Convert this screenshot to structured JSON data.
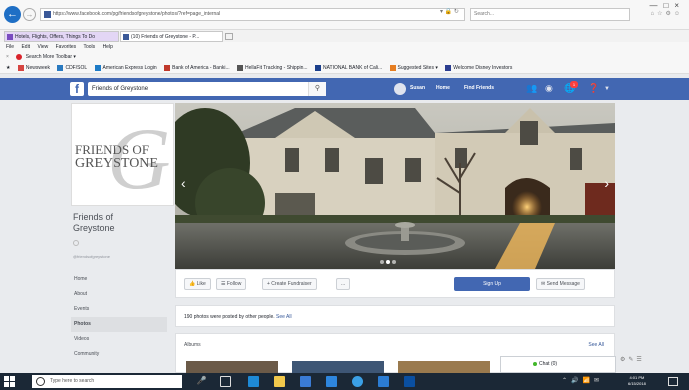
{
  "browser": {
    "address": "https://www.facebook.com/pg/friendsofgreystone/photos/?ref=page_internal",
    "search_placeholder": "Search...",
    "tabs": [
      {
        "label": "Hotels, Flights, Offers, Things To Do"
      },
      {
        "label": "(10) Friends of Greystone - P..."
      }
    ],
    "menu": [
      "File",
      "Edit",
      "View",
      "Favorites",
      "Tools",
      "Help"
    ],
    "toolbar": {
      "close": "×",
      "label": "Search More Toolbar ▾"
    },
    "favorites": [
      "Newsweek",
      "CDF/SOL",
      "American Express Login",
      "Bank of America - Banki...",
      "HellaFit Tracking - Shippin...",
      "NATIONAL BANK of Cali...",
      "Suggested Sites ▾",
      "Welcome Disney Investors"
    ]
  },
  "facebook": {
    "search_value": "Friends of Greystone",
    "user_name": "Susan",
    "nav_home": "Home",
    "nav_find_friends": "Find Friends",
    "notif_count": "1"
  },
  "page": {
    "logo_line1": "FRIENDS OF",
    "logo_line2": "GREYSTONE",
    "name": "Friends of Greystone",
    "handle": "@friendsofgreystone",
    "nav": [
      "Home",
      "About",
      "Events",
      "Photos",
      "Videos",
      "Community"
    ],
    "active_nav": "Photos",
    "actions": {
      "like": "Like",
      "follow": "Follow",
      "fundraiser": "+ Create Fundraiser",
      "more": "...",
      "signup": "Sign Up",
      "message": "Send Message"
    },
    "notice_text": "190 photos were posted by other people.",
    "notice_link": "See All",
    "albums_title": "Albums",
    "albums_see_all": "See All"
  },
  "chat": {
    "label": "Chat (0)"
  },
  "taskbar": {
    "search_placeholder": "Type here to search",
    "time": "4:01 PM",
    "date": "6/15/2018"
  },
  "colors": {
    "fb_blue": "#4267b2",
    "taskbar": "#1b2836",
    "page_bg": "#e9ebee"
  }
}
